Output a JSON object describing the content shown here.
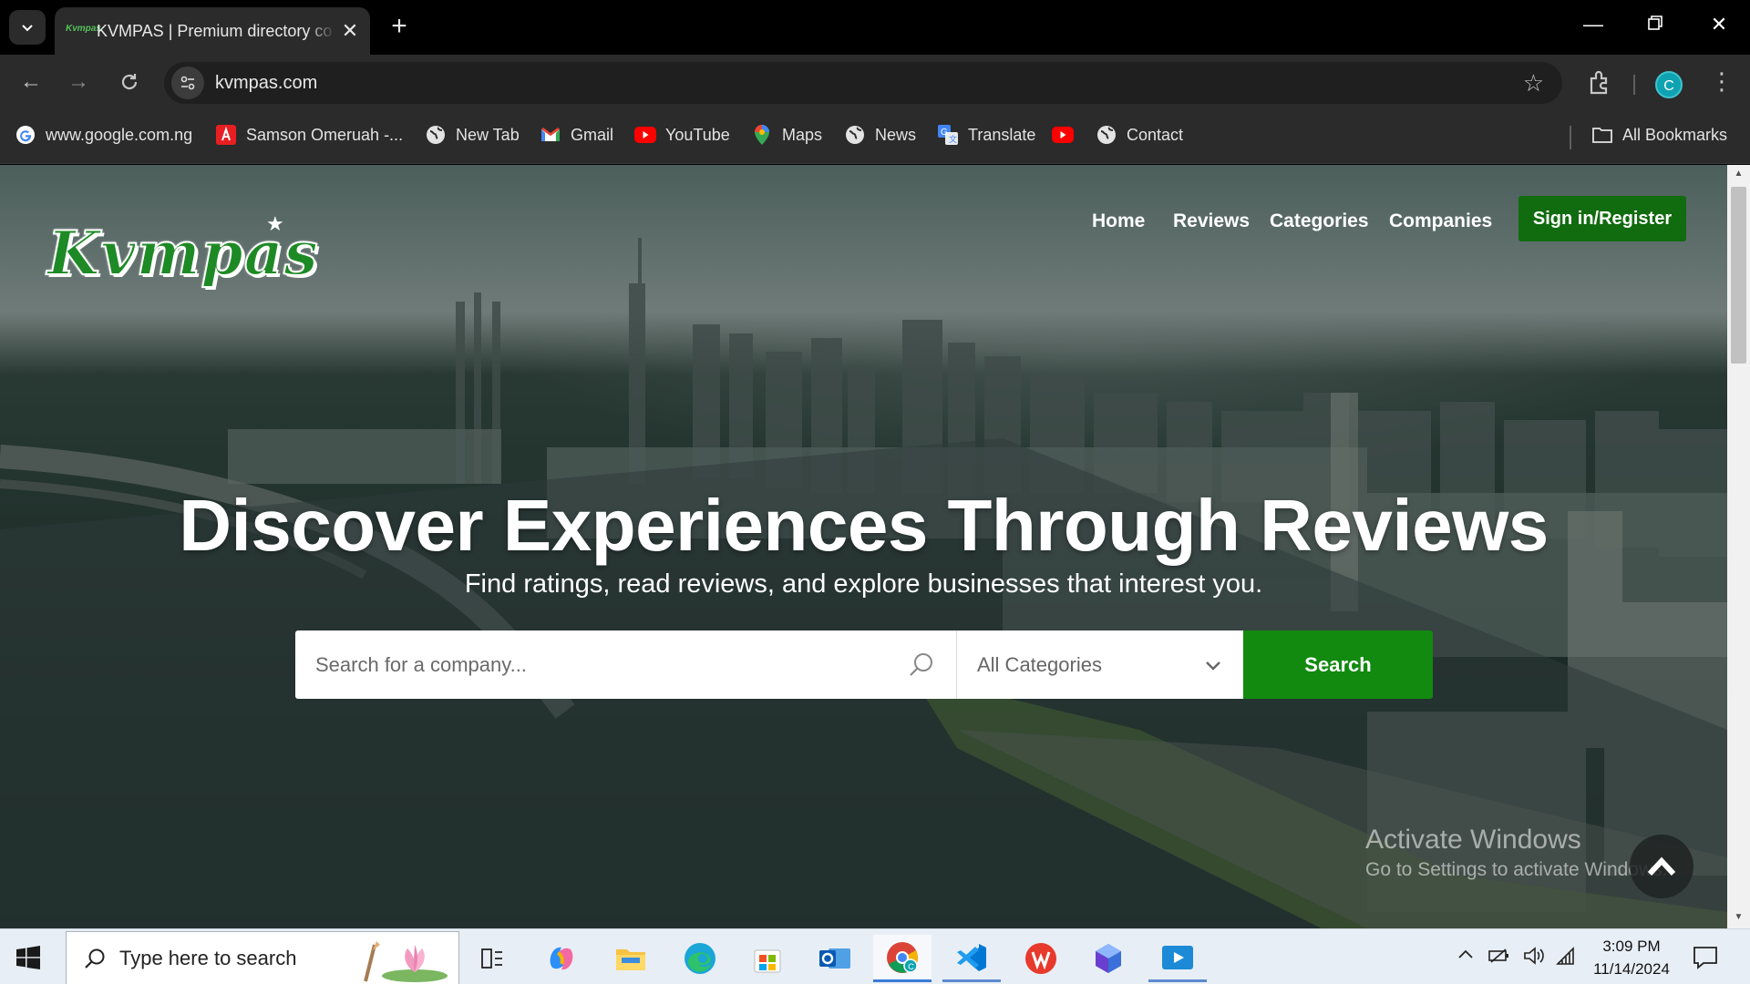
{
  "browser": {
    "tab_title": "KVMPAS | Premium directory co",
    "tab_favicon_text": "Kvmpas",
    "url": "kvmpas.com",
    "profile_initial": "C",
    "bookmarks": [
      {
        "label": "www.google.com.ng",
        "icon": "google-icon"
      },
      {
        "label": "Samson Omeruah -...",
        "icon": "acrobat-icon"
      },
      {
        "label": "New Tab",
        "icon": "globe-icon"
      },
      {
        "label": "Gmail",
        "icon": "gmail-icon"
      },
      {
        "label": "YouTube",
        "icon": "youtube-icon"
      },
      {
        "label": "Maps",
        "icon": "maps-icon"
      },
      {
        "label": "News",
        "icon": "globe-icon"
      },
      {
        "label": "Translate",
        "icon": "translate-icon"
      },
      {
        "label": "",
        "icon": "youtube-icon"
      },
      {
        "label": "Contact",
        "icon": "globe-icon"
      }
    ],
    "all_bookmarks_label": "All Bookmarks"
  },
  "site": {
    "logo_text": "Kvmpas",
    "nav": [
      "Home",
      "Reviews",
      "Categories",
      "Companies"
    ],
    "signin_label": "Sign in/Register",
    "hero_title": "Discover Experiences Through Reviews",
    "hero_subtitle": "Find ratings, read reviews, and explore businesses that interest you.",
    "search_placeholder": "Search for a company...",
    "category_selected": "All Categories",
    "search_button": "Search",
    "brand_green": "#118a0f"
  },
  "watermark": {
    "title": "Activate Windows",
    "subtitle": "Go to Settings to activate Windows."
  },
  "taskbar": {
    "search_placeholder": "Type here to search",
    "time": "3:09 PM",
    "date": "11/14/2024"
  }
}
